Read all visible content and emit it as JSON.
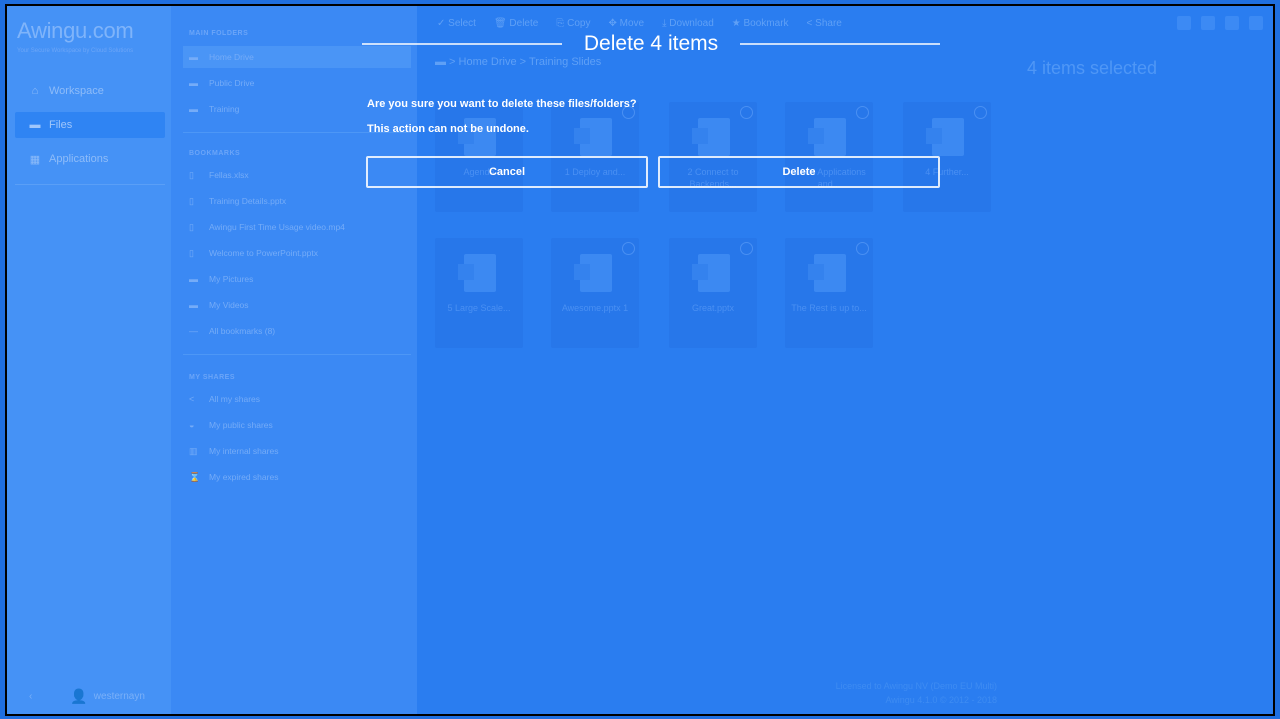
{
  "app": {
    "logo": "Awingu.com",
    "logo_sub": "Your Secure Workspace by Cloud Solutions"
  },
  "leftnav": {
    "items": [
      {
        "icon": "home-icon",
        "glyph": "⌂",
        "label": "Workspace"
      },
      {
        "icon": "folder-icon",
        "glyph": "▬",
        "label": "Files"
      },
      {
        "icon": "grid-icon",
        "glyph": "▦",
        "label": "Applications"
      }
    ],
    "user": {
      "name": "westernayn"
    }
  },
  "folders": {
    "main_header": "MAIN FOLDERS",
    "main_items": [
      "Home Drive",
      "Public Drive",
      "Training"
    ],
    "bookmarks_header": "BOOKMARKS",
    "bookmarks": [
      "Fellas.xlsx",
      "Training Details.pptx",
      "Awingu First Time Usage video.mp4",
      "Welcome to PowerPoint.pptx",
      "My Pictures",
      "My Videos",
      "All bookmarks (8)"
    ],
    "shares_header": "MY SHARES",
    "shares": [
      "All my shares",
      "My public shares",
      "My internal shares",
      "My expired shares"
    ]
  },
  "toolbar": [
    "✓ Select",
    "🗑 Delete",
    "⎘ Copy",
    "✥ Move",
    "⤓ Download",
    "★ Bookmark",
    "< Share"
  ],
  "breadcrumb": "▬  >  Home Drive  >  Training Slides",
  "selection": "4 items selected",
  "tiles": [
    {
      "label": "Agenda",
      "checked": false
    },
    {
      "label": "1 Deploy and...",
      "checked": true
    },
    {
      "label": "2 Connect to Backends...",
      "checked": true
    },
    {
      "label": "3 Add Applications and...",
      "checked": true
    },
    {
      "label": "4 Further...",
      "checked": true
    },
    {
      "label": "5 Large Scale...",
      "checked": false
    },
    {
      "label": "Awesome.pptx 1",
      "checked": true
    },
    {
      "label": "Great.pptx",
      "checked": true
    },
    {
      "label": "The Rest is up to...",
      "checked": true
    }
  ],
  "license": {
    "line1": "Licensed to Awingu NV (Demo EU Multi)",
    "line2": "Awingu 4.1.0 © 2012 - 2018"
  },
  "modal": {
    "title": "Delete 4 items",
    "message1": "Are you sure you want to delete these files/folders?",
    "message2": "This action can not be undone.",
    "cancel_label": "Cancel",
    "delete_label": "Delete"
  },
  "colors": {
    "overlay": "#2a7df0",
    "accent": "#ffffff"
  }
}
